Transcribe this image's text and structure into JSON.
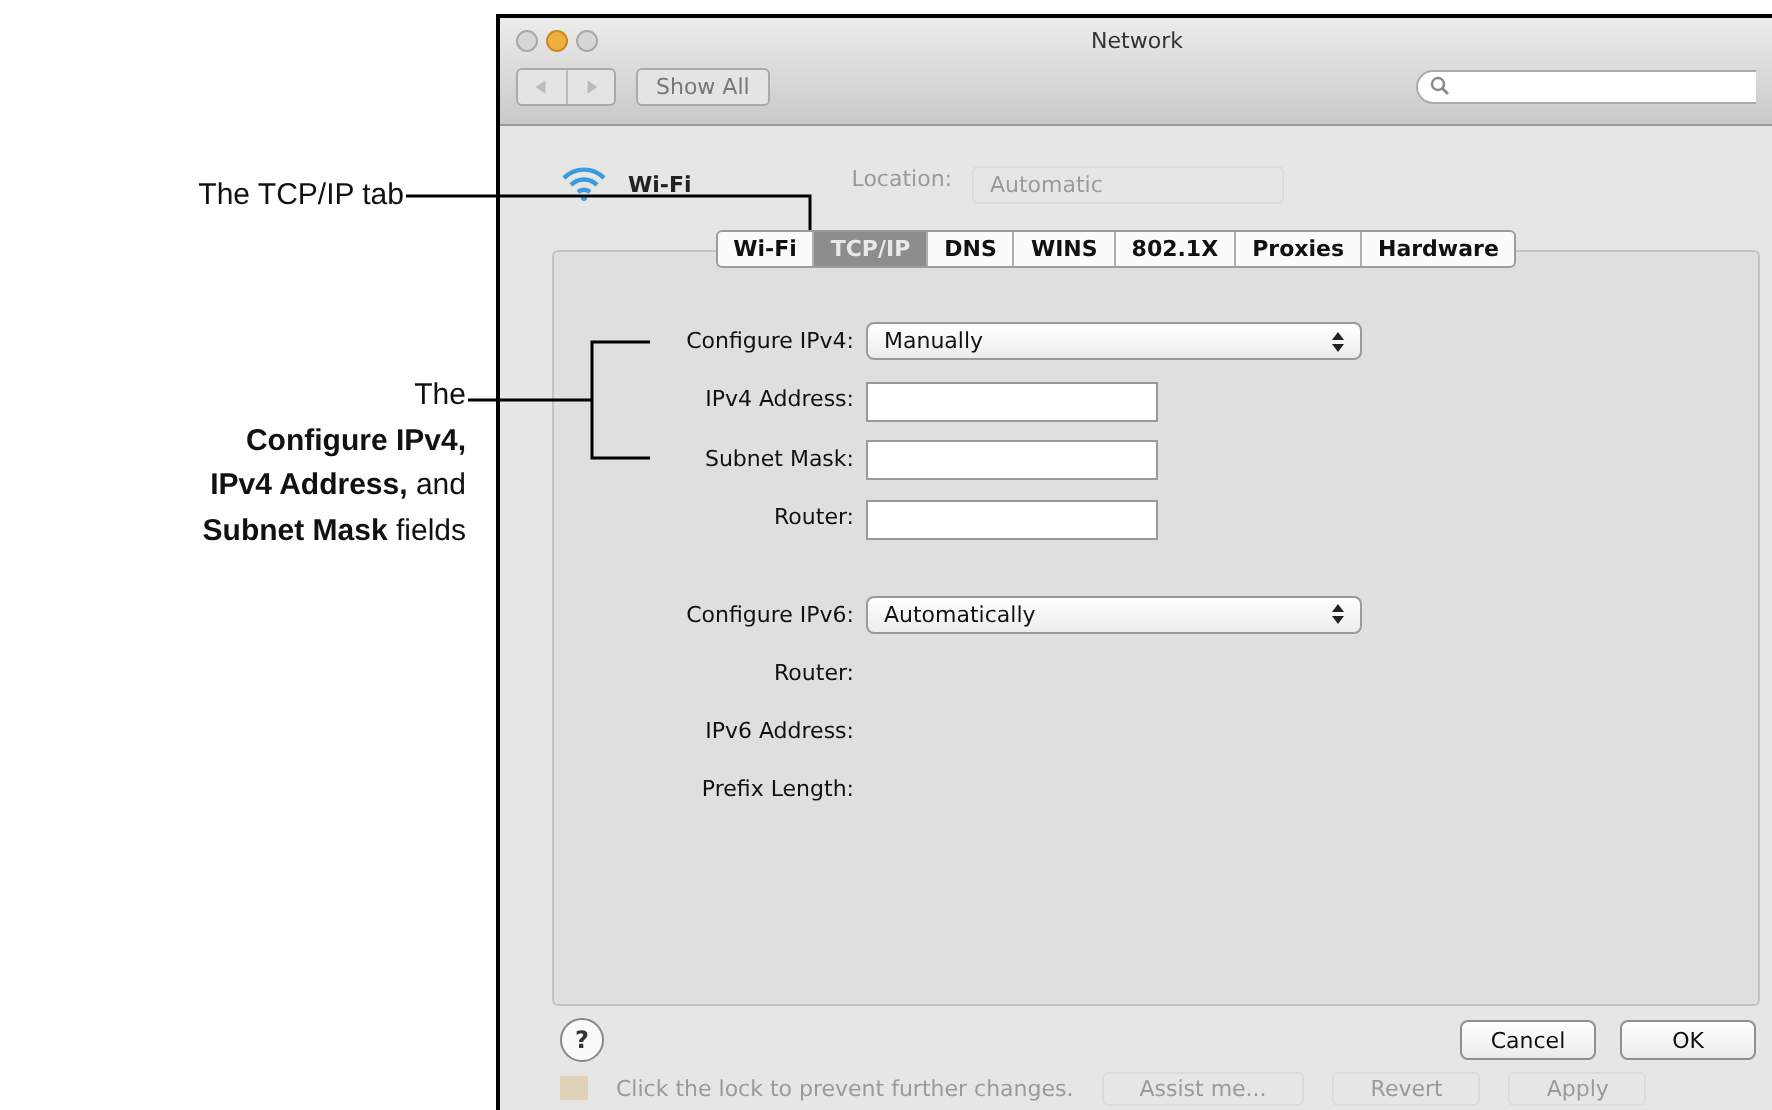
{
  "annotations": [
    {
      "text": "The TCP/IP tab"
    },
    {
      "text": "The\n**Configure IPv4,**\n**IPv4 Address,** and\n**Subnet Mask** fields"
    }
  ],
  "window": {
    "title": "Network",
    "show_all": "Show All"
  },
  "pane": {
    "service": "Wi-Fi",
    "location_label": "Location:",
    "location_value": "Automatic"
  },
  "tabs": [
    {
      "label": "Wi-Fi",
      "selected": false
    },
    {
      "label": "TCP/IP",
      "selected": true
    },
    {
      "label": "DNS",
      "selected": false
    },
    {
      "label": "WINS",
      "selected": false
    },
    {
      "label": "802.1X",
      "selected": false
    },
    {
      "label": "Proxies",
      "selected": false
    },
    {
      "label": "Hardware",
      "selected": false
    }
  ],
  "fields": [
    {
      "kind": "popup",
      "label": "Configure IPv4:",
      "value": "Manually"
    },
    {
      "kind": "text",
      "label": "IPv4 Address:"
    },
    {
      "kind": "text",
      "label": "Subnet Mask:"
    },
    {
      "kind": "text",
      "label": "Router:"
    },
    {
      "kind": "popup",
      "label": "Configure IPv6:",
      "value": "Automatically"
    },
    {
      "kind": "info",
      "label": "Router:"
    },
    {
      "kind": "info",
      "label": "IPv6 Address:"
    },
    {
      "kind": "info",
      "label": "Prefix Length:"
    }
  ],
  "sheet_buttons": {
    "help": "?",
    "buttons": [
      "Cancel",
      "OK"
    ]
  },
  "footer": {
    "lock_text": "Click the lock to prevent further changes.",
    "buttons": [
      "Assist me...",
      "Revert",
      "Apply"
    ]
  }
}
